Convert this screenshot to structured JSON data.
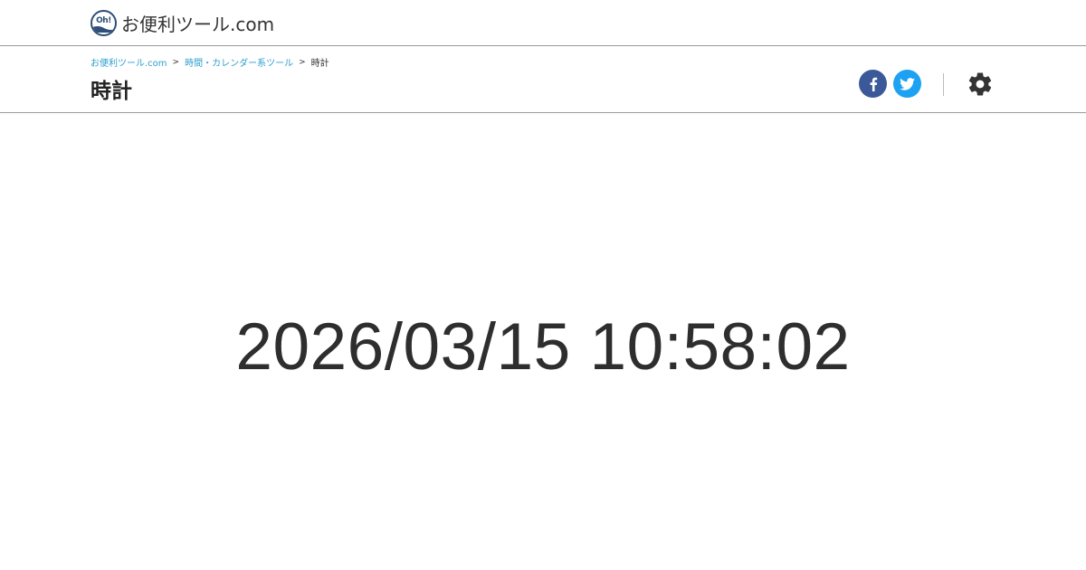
{
  "site": {
    "logo_badge_text": "Oh!",
    "logo_text": "お便利ツール.com",
    "brand_color": "#2f4f78"
  },
  "breadcrumb": {
    "items": [
      {
        "label": "お便利ツール.com",
        "link": true
      },
      {
        "label": "時間・カレンダー系ツール",
        "link": true
      },
      {
        "label": "時計",
        "link": false
      }
    ],
    "separator": ">",
    "link_color": "#2e9fd0"
  },
  "page": {
    "title": "時計"
  },
  "share": {
    "facebook": {
      "icon": "facebook-icon",
      "color": "#3b5998"
    },
    "twitter": {
      "icon": "twitter-icon",
      "color": "#1da1f2"
    }
  },
  "settings": {
    "icon": "gear-icon"
  },
  "clock": {
    "display": "2026/03/15 10:58:02"
  }
}
